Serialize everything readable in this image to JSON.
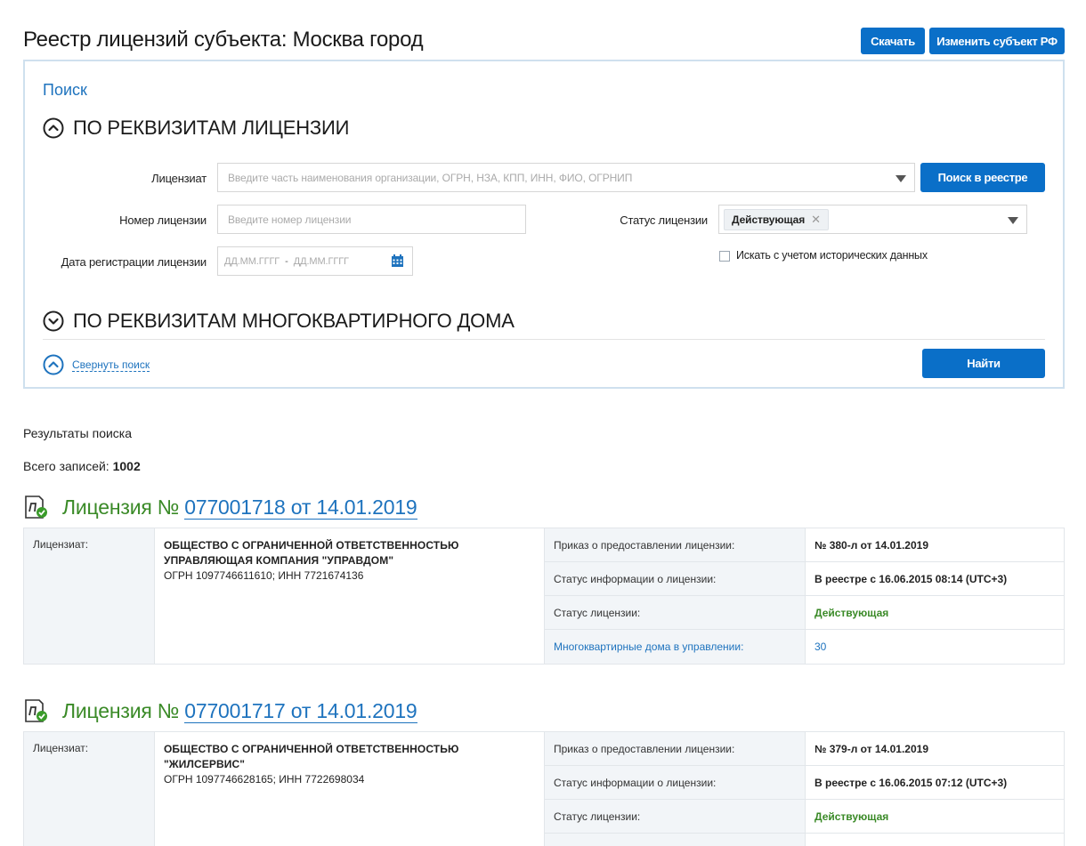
{
  "header": {
    "title": "Реестр лицензий субъекта: Москва город",
    "download_label": "Скачать",
    "change_subject_label": "Изменить субъект РФ"
  },
  "search": {
    "title": "Поиск",
    "section_license": "ПО РЕКВИЗИТАМ ЛИЦЕНЗИИ",
    "section_house": "ПО РЕКВИЗИТАМ МНОГОКВАРТИРНОГО ДОМА",
    "licensee_label": "Лицензиат",
    "licensee_placeholder": "Введите часть наименования организации, ОГРН, НЗА, КПП, ИНН, ФИО, ОГРНИП",
    "registry_search_label": "Поиск в реестре",
    "license_number_label": "Номер лицензии",
    "license_number_placeholder": "Введите номер лицензии",
    "status_label": "Статус лицензии",
    "status_value": "Действующая",
    "reg_date_label": "Дата регистрации лицензии",
    "date_from_placeholder": "ДД.ММ.ГГГГ",
    "date_sep": "-",
    "date_to_placeholder": "ДД.ММ.ГГГГ",
    "historical_label": "Искать с учетом исторических данных",
    "collapse_label": "Свернуть поиск",
    "find_label": "Найти"
  },
  "results": {
    "title": "Результаты поиска",
    "total_label": "Всего записей:",
    "total_value": "1002",
    "licenses": [
      {
        "prefix": "Лицензия №",
        "number": "077001718 от 14.01.2019",
        "licensee_label": "Лицензиат:",
        "org_line1": "ОБЩЕСТВО С ОГРАНИЧЕННОЙ ОТВЕТСТВЕННОСТЬЮ",
        "org_line2": "УПРАВЛЯЮЩАЯ КОМПАНИЯ \"УПРАВДОМ\"",
        "ids": "ОГРН 1097746611610; ИНН 7721674136",
        "order_label": "Приказ о предоставлении лицензии:",
        "order_value": "№ 380-л от 14.01.2019",
        "info_status_label": "Статус информации о лицензии:",
        "info_status_value": "В реестре с 16.06.2015 08:14 (UTC+3)",
        "status_label": "Статус лицензии:",
        "status_value": "Действующая",
        "houses_label": "Многоквартирные дома в управлении:",
        "houses_value": "30"
      },
      {
        "prefix": "Лицензия №",
        "number": "077001717 от 14.01.2019",
        "licensee_label": "Лицензиат:",
        "org_line1": "ОБЩЕСТВО С ОГРАНИЧЕННОЙ ОТВЕТСТВЕННОСТЬЮ",
        "org_line2": "\"ЖИЛСЕРВИС\"",
        "ids": "ОГРН 1097746628165; ИНН 7722698034",
        "order_label": "Приказ о предоставлении лицензии:",
        "order_value": "№ 379-л от 14.01.2019",
        "info_status_label": "Статус информации о лицензии:",
        "info_status_value": "В реестре с 16.06.2015 07:12 (UTC+3)",
        "status_label": "Статус лицензии:",
        "status_value": "Действующая"
      }
    ]
  },
  "colors": {
    "accent": "#0a6fc8",
    "link": "#1e73be",
    "green": "#3a8a27"
  }
}
